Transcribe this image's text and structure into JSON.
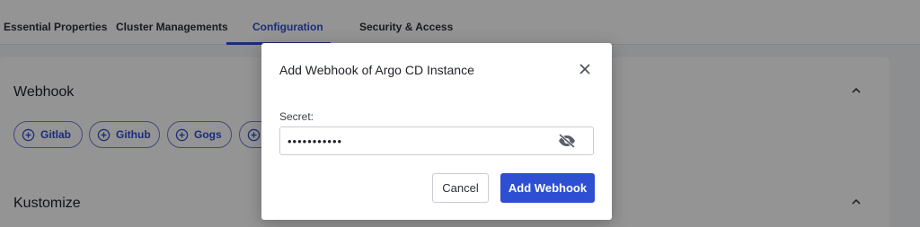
{
  "tabs": [
    {
      "label": "Essential Properties"
    },
    {
      "label": "Cluster Managements"
    },
    {
      "label": "Configuration"
    },
    {
      "label": "Security & Access"
    }
  ],
  "active_tab": "Configuration",
  "sections": {
    "webhook": {
      "title": "Webhook"
    },
    "kustomize": {
      "title": "Kustomize"
    }
  },
  "webhook_chips": [
    {
      "label": "Gitlab",
      "icon": "plus-circle-icon"
    },
    {
      "label": "Github",
      "icon": "plus-circle-icon"
    },
    {
      "label": "Gogs",
      "icon": "plus-circle-icon"
    },
    {
      "label": "",
      "icon": "plus-circle-icon"
    }
  ],
  "dialog": {
    "title": "Add Webhook of Argo CD Instance",
    "secret_label": "Secret:",
    "secret_value": "•••••••••••",
    "cancel_label": "Cancel",
    "submit_label": "Add Webhook"
  },
  "colors": {
    "accent": "#2e4fd1",
    "overlay": "rgba(0,0,0,0.42)"
  }
}
